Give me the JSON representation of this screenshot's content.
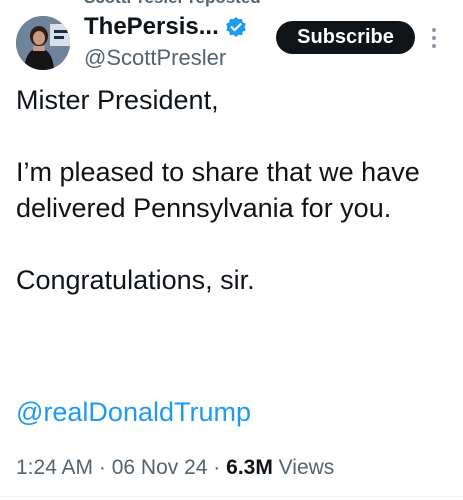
{
  "repost_banner": {
    "text": "ScottPresler reposted"
  },
  "author": {
    "display_name": "ThePersis...",
    "handle": "@ScottPresler",
    "verified": true,
    "avatar_icon": "profile-photo"
  },
  "actions": {
    "subscribe_label": "Subscribe",
    "more_icon": "more-vertical-icon"
  },
  "post": {
    "paragraphs": [
      "Mister President,",
      "I’m pleased to share that we have delivered Pennsylvania for you.",
      "Congratulations, sir."
    ],
    "mention": "@realDonaldTrump"
  },
  "meta": {
    "time": "1:24 AM",
    "separator": " · ",
    "date": "06 Nov 24",
    "views_count": "6.3M",
    "views_label": " Views"
  },
  "colors": {
    "link": "#1d9bf0",
    "secondary_text": "#536471",
    "primary_text": "#0f1419",
    "verified_badge": "#1d9bf0"
  }
}
